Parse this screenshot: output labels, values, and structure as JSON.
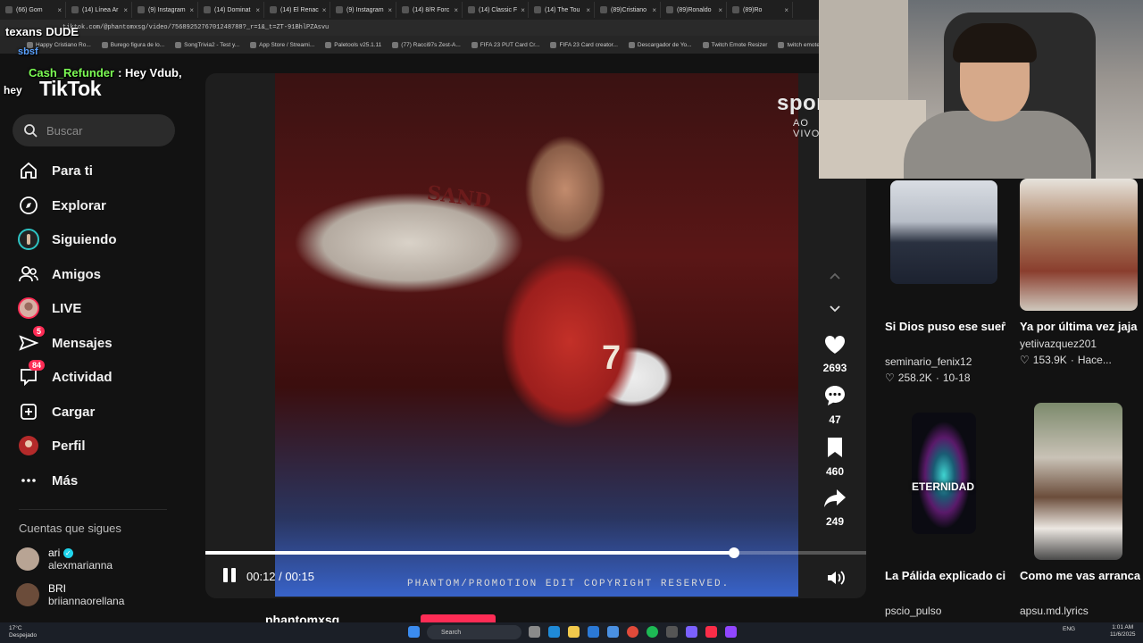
{
  "browser": {
    "tabs": [
      "(66) Gom",
      "(14) Línea Ar",
      "(9) Instagram",
      "(14) Dominat",
      "(14) El Renac",
      "(9) Instagram",
      "(14) 8/R Forc",
      "(14) Classic F",
      "(14) The Tou",
      "(89)Cristiano",
      "(89)Ronaldo",
      "(89)Ro"
    ],
    "url": "tiktok.com/@phantomxsg/video/7568925276701248788?_r=1&_t=ZT-91BhlPZAsvu",
    "bookmarks": [
      "Happy Cristiano Ro...",
      "Burego figura de lo...",
      "SongTrivia2 - Test y...",
      "App Store / Streami...",
      "Paletools v25.1.11",
      "(77) Racci97s Zest-A...",
      "FIFA 23 PUT Card Cr...",
      "FIFA 23 Card creator...",
      "Descargador de Yo...",
      "Twitch Emote Resizer",
      "twitch emote res"
    ]
  },
  "chat": [
    {
      "user": "texans",
      "message": "DUDE"
    },
    {
      "user": "",
      "message": "sbsf"
    },
    {
      "user": "Cash_Refunder",
      "message": ": Hey Vdub,"
    },
    {
      "user": "",
      "message": "hey"
    }
  ],
  "tiktok": {
    "logo": "TikTok",
    "search_placeholder": "Buscar",
    "nav": [
      {
        "label": "Para ti",
        "icon": "home-icon"
      },
      {
        "label": "Explorar",
        "icon": "compass-icon"
      },
      {
        "label": "Siguiendo",
        "icon": "following-avatar-icon"
      },
      {
        "label": "Amigos",
        "icon": "friends-icon"
      },
      {
        "label": "LIVE",
        "icon": "live-avatar-icon"
      },
      {
        "label": "Mensajes",
        "icon": "send-icon",
        "badge": "5"
      },
      {
        "label": "Actividad",
        "icon": "inbox-icon",
        "badge": "84"
      },
      {
        "label": "Cargar",
        "icon": "plus-square-icon"
      },
      {
        "label": "Perfil",
        "icon": "profile-avatar-icon"
      },
      {
        "label": "Más",
        "icon": "more-icon"
      }
    ],
    "following_title": "Cuentas que sigues",
    "following": [
      {
        "name": "ari",
        "handle": "alexmarianna",
        "verified": true
      },
      {
        "name": "BRI",
        "handle": "briiannaorellana",
        "verified": false
      }
    ]
  },
  "video": {
    "watermark": "sportv",
    "watermark_sub": "AO VIVO",
    "jersey_number": "7",
    "banner_text": "SAND",
    "copyright": "PHANTOM/PROMOTION EDIT COPYRIGHT RESERVED.",
    "current_time": "00:12",
    "separator": "/",
    "duration": "00:15",
    "progress": 0.8,
    "username": "phantomxsg"
  },
  "actions": {
    "likes": "2693",
    "comments": "47",
    "saves": "460",
    "shares": "249"
  },
  "feed": [
    {
      "title": "Si Dios puso ese sueño en tu corazó...",
      "author": "seminario_fenix12",
      "likes": "258.2K",
      "date": "10-18"
    },
    {
      "title": "Ya por última vez jaja",
      "author": "yetiivazquez201",
      "likes": "153.9K",
      "date": "Hace..."
    },
    {
      "title": "La Pálida explicado científicamente🩷...",
      "author": "pscio_pulso",
      "overlay": "ETERNIDAD"
    },
    {
      "title": "Como me vas arrancar la cadena...",
      "author": "apsu.md.lyrics"
    }
  ],
  "taskbar": {
    "weather_temp": "17°C",
    "weather_desc": "Despejado",
    "search": "Search",
    "lang": "ENG",
    "time": "1:01 AM",
    "date": "11/6/2025"
  },
  "colors": {
    "accent": "#fe2c55",
    "background": "#121212"
  }
}
